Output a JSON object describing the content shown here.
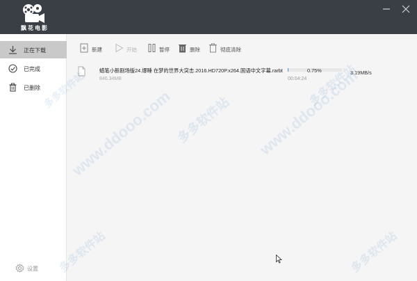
{
  "app": {
    "name": "飘花电影"
  },
  "window_controls": {
    "minimize_icon": "minimize-icon",
    "close_icon": "close-icon"
  },
  "sidebar": {
    "items": [
      {
        "label": "正在下载",
        "icon": "download-icon",
        "active": true
      },
      {
        "label": "已完成",
        "icon": "check-circle-icon",
        "active": false
      },
      {
        "label": "已删除",
        "icon": "trash-icon",
        "active": false
      }
    ],
    "settings_label": "设置"
  },
  "toolbar": {
    "new_label": "新建",
    "start_label": "开始",
    "pause_label": "暂停",
    "delete_label": "删除",
    "clear_label": "彻底清除"
  },
  "task": {
    "file_name": "蜡笔小新剧场版24.爆睡 在梦的世界大突击.2016.HD720P.x264.国语中文字幕.rarbt",
    "file_size": "846.34MB",
    "progress_percent": 0.75,
    "progress_label": "0.75%",
    "elapsed": "00:04:24",
    "speed": "3.19MB/s"
  },
  "watermark": {
    "text_cn": "多多软件站",
    "text_en": "www.ddooo.com"
  },
  "colors": {
    "titlebar": "#3a3f45",
    "sidebar_active": "#c9c9c9",
    "progress": "#4a90d9"
  }
}
